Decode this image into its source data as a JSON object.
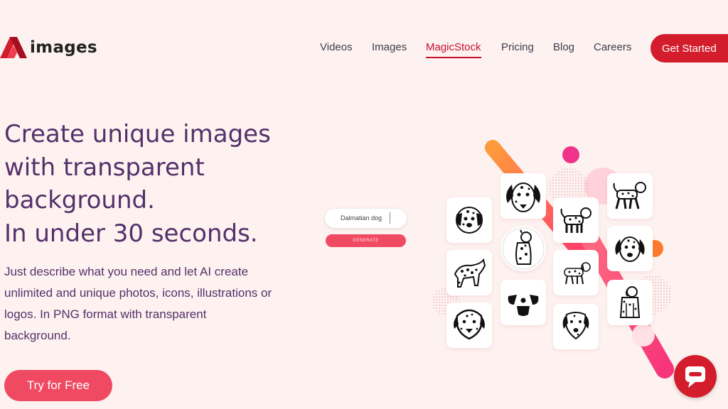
{
  "header": {
    "logo_text": "images",
    "nav": [
      {
        "label": "Videos",
        "active": false
      },
      {
        "label": "Images",
        "active": false
      },
      {
        "label": "MagicStock",
        "active": true
      },
      {
        "label": "Pricing",
        "active": false
      },
      {
        "label": "Blog",
        "active": false
      },
      {
        "label": "Careers",
        "active": false
      }
    ],
    "cta_label": "Get Started"
  },
  "hero": {
    "headline_lines": [
      "Create unique images",
      "with transparent",
      "background.",
      "In under 30 seconds."
    ],
    "description_lines": [
      "Just describe what you need and let AI create",
      "unlimited and unique photos, icons, illustrations or",
      "logos. In PNG format with transparent",
      "background."
    ],
    "cta_label": "Try for Free"
  },
  "illustration": {
    "prompt_value": "Dalmatian dog",
    "generate_label": "GENERATE",
    "tiles": [
      {
        "icon": "dalmatian-face-round-icon"
      },
      {
        "icon": "dalmatian-head-icon"
      },
      {
        "icon": "dalmatian-standing-icon"
      },
      {
        "icon": "dalmatian-sitting-icon"
      },
      {
        "icon": "dalmatian-spotted-body-icon"
      },
      {
        "icon": "dalmatian-walking-icon"
      },
      {
        "icon": "dalmatian-head-outline-icon"
      },
      {
        "icon": "dog-face-minimal-icon"
      },
      {
        "icon": "dalmatian-face-icon"
      },
      {
        "icon": "dalmatian-lineart-icon"
      },
      {
        "icon": "dalmatian-walking-lineart-icon"
      },
      {
        "icon": "dalmatian-sitting-lineart-icon"
      }
    ]
  },
  "colors": {
    "background": "#fdf2f0",
    "brand_red": "#d31c2c",
    "cta_pink": "#f04a63",
    "headline_purple": "#54306a"
  },
  "chat": {
    "icon": "chat-bubble-icon"
  }
}
